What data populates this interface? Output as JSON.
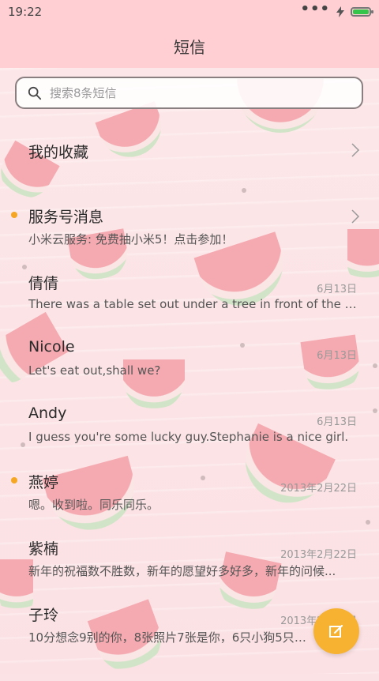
{
  "status_bar": {
    "time": "19:22"
  },
  "header": {
    "title": "短信"
  },
  "search": {
    "placeholder": "搜索8条短信"
  },
  "favorites": {
    "label": "我的收藏"
  },
  "threads": [
    {
      "name": "服务号消息",
      "preview": "小米云服务: 免费抽小米5！点击参加！",
      "date": "",
      "unread": true
    },
    {
      "name": "倩倩",
      "preview": "There was a table set out under a tree in front of the ho...",
      "date": "6月13日",
      "unread": false
    },
    {
      "name": "Nicole",
      "preview": "Let's eat out,shall we?",
      "date": "6月13日",
      "unread": false
    },
    {
      "name": "Andy",
      "preview": "I guess you're some lucky guy.Stephanie is a nice girl.",
      "date": "6月13日",
      "unread": false
    },
    {
      "name": "燕婷",
      "preview": "嗯。收到啦。同乐同乐。",
      "date": "2013年2月22日",
      "unread": true
    },
    {
      "name": "紫楠",
      "preview": "新年的祝福数不胜数，新年的愿望好多好多，新年的问候...",
      "date": "2013年2月22日",
      "unread": false
    },
    {
      "name": "子玲",
      "preview": "10分想念9别的你，8张照片7张是你，6只小狗5只像你...",
      "date": "2013年2月22日",
      "unread": false
    }
  ],
  "colors": {
    "header_bg": "#ffcfd3",
    "accent": "#f7b232",
    "unread_dot": "#f5a623"
  }
}
